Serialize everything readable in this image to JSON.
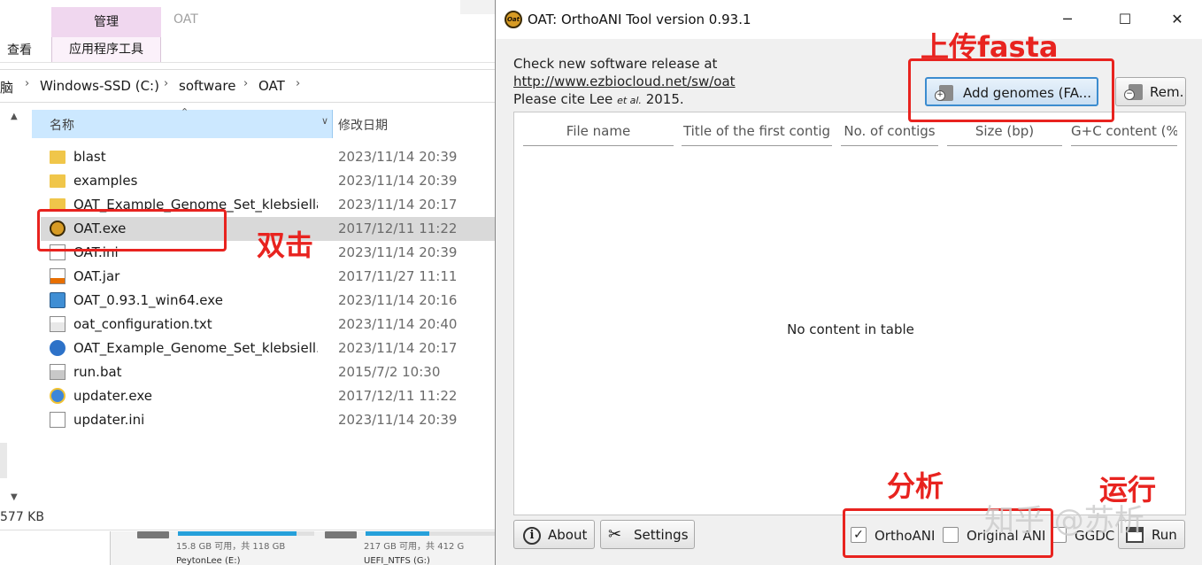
{
  "explorer": {
    "ribbon": {
      "manage_tab": "管理",
      "app_tools_tab": "应用程序工具",
      "view_tab": "查看",
      "oat_title": "OAT"
    },
    "address": {
      "first": "脑",
      "drive": "Windows-SSD (C:)",
      "folder1": "software",
      "folder2": "OAT",
      "separator": "›"
    },
    "columns": {
      "name": "名称",
      "date": "修改日期"
    },
    "files": [
      {
        "name": "blast",
        "date": "2023/11/14 20:39",
        "icon": "folder-icon"
      },
      {
        "name": "examples",
        "date": "2023/11/14 20:39",
        "icon": "folder-icon"
      },
      {
        "name": "OAT_Example_Genome_Set_klebsiella",
        "date": "2023/11/14 20:17",
        "icon": "folder-icon"
      },
      {
        "name": "OAT.exe",
        "date": "2017/12/11 11:22",
        "icon": "oat-app-icon"
      },
      {
        "name": "OAT.ini",
        "date": "2023/11/14 20:39",
        "icon": "ini-file-icon"
      },
      {
        "name": "OAT.jar",
        "date": "2017/11/27 11:11",
        "icon": "java-jar-icon"
      },
      {
        "name": "OAT_0.93.1_win64.exe",
        "date": "2023/11/14 20:16",
        "icon": "installer-icon"
      },
      {
        "name": "oat_configuration.txt",
        "date": "2023/11/14 20:40",
        "icon": "text-file-icon"
      },
      {
        "name": "OAT_Example_Genome_Set_klebsiell...",
        "date": "2023/11/14 20:17",
        "icon": "zip-file-icon"
      },
      {
        "name": "run.bat",
        "date": "2015/7/2 10:30",
        "icon": "batch-file-icon"
      },
      {
        "name": "updater.exe",
        "date": "2017/12/11 11:22",
        "icon": "updater-exe-icon"
      },
      {
        "name": "updater.ini",
        "date": "2023/11/14 20:39",
        "icon": "ini-file-icon"
      }
    ],
    "status_size": "577 KB",
    "drives": [
      {
        "capacity": "15.8 GB 可用，共 118 GB",
        "label": "PeytonLee (E:)",
        "used_fraction": 0.87
      },
      {
        "capacity": "217 GB 可用，共 412 G",
        "label": "UEFI_NTFS (G:)",
        "used_fraction": 0.47
      }
    ]
  },
  "oat": {
    "title": "OAT: OrthoANI Tool version 0.93.1",
    "icon_text": "Oat",
    "window_controls": {
      "minimize": "─",
      "maximize": "☐",
      "close": "✕"
    },
    "info": {
      "line1": "Check new software release at",
      "link": "http://www.ezbiocloud.net/sw/oat",
      "cite_prefix": "Please cite Lee ",
      "cite_etal": "et al.",
      "cite_suffix": " 2015."
    },
    "buttons": {
      "add": "Add genomes (FA...",
      "remove": "Rem...",
      "about": "About",
      "settings": "Settings",
      "run": "Run"
    },
    "table": {
      "headers": [
        "File name",
        "Title of the first contig",
        "No. of contigs",
        "Size (bp)",
        "G+C content (%)"
      ],
      "empty": "No content in table"
    },
    "options": [
      {
        "label": "OrthoANI",
        "checked": true
      },
      {
        "label": "Original ANI",
        "checked": false
      },
      {
        "label": "GGDC",
        "checked": false
      }
    ],
    "checkmark": "✓"
  },
  "annotations": {
    "double_click": "双击",
    "upload": "上传fasta",
    "analyze": "分析",
    "run": "运行",
    "watermark": "知乎 @苏析",
    "color": "#e8231f"
  }
}
